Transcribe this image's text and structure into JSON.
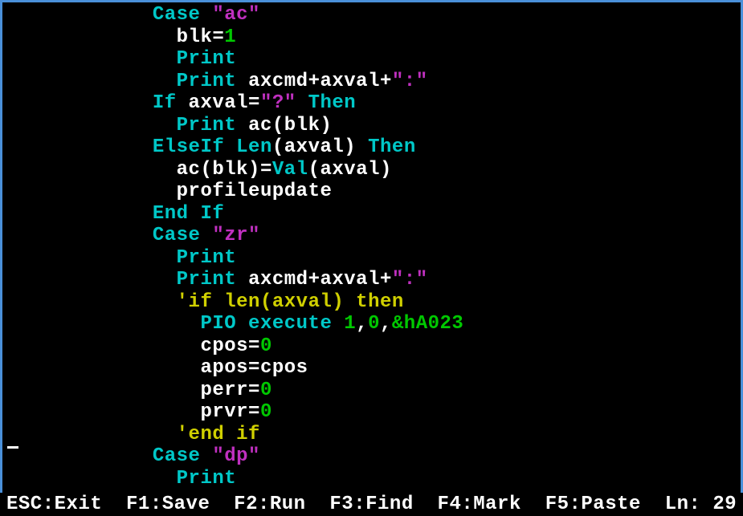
{
  "code": {
    "l1": {
      "indent": "            ",
      "kw": "Case",
      "sp": " ",
      "str": "\"ac\""
    },
    "l2": {
      "indent": "              ",
      "v1": "blk=",
      "num": "1"
    },
    "l3": {
      "indent": "              ",
      "kw": "Print"
    },
    "l4": {
      "indent": "              ",
      "kw": "Print",
      "sp": " ",
      "v1": "axcmd+axval+",
      "str": "\":\""
    },
    "l5": {
      "indent": "            ",
      "kw1": "If",
      "sp1": " ",
      "v1": "axval=",
      "str": "\"?\"",
      "sp2": " ",
      "kw2": "Then"
    },
    "l6": {
      "indent": "              ",
      "kw": "Print",
      "sp": " ",
      "v1": "ac(blk)"
    },
    "l7": {
      "indent": "            ",
      "kw1": "ElseIf",
      "sp1": " ",
      "kw2": "Len",
      "v1": "(axval)",
      "sp2": " ",
      "kw3": "Then"
    },
    "l8": {
      "indent": "              ",
      "v1": "ac(blk)=",
      "kw": "Val",
      "v2": "(axval)"
    },
    "l9": {
      "indent": "              ",
      "v1": "profileupdate"
    },
    "l10": {
      "indent": "            ",
      "kw": "End If"
    },
    "l11": {
      "indent": "            ",
      "kw": "Case",
      "sp": " ",
      "str": "\"zr\""
    },
    "l12": {
      "indent": "              ",
      "kw": "Print"
    },
    "l13": {
      "indent": "              ",
      "kw": "Print",
      "sp": " ",
      "v1": "axcmd+axval+",
      "str": "\":\""
    },
    "l14": {
      "indent": "              ",
      "comment": "'if len(axval) then"
    },
    "l15": {
      "indent": "                ",
      "kw": "PIO execute",
      "sp": " ",
      "n1": "1",
      "c1": ",",
      "n2": "0",
      "c2": ",",
      "n3": "&hA023"
    },
    "l16": {
      "indent": "                ",
      "v1": "cpos=",
      "num": "0"
    },
    "l17": {
      "indent": "                ",
      "v1": "apos=cpos"
    },
    "l18": {
      "indent": "                ",
      "v1": "perr=",
      "num": "0"
    },
    "l19": {
      "indent": "                ",
      "v1": "prvr=",
      "num": "0"
    },
    "l20": {
      "indent": "              ",
      "comment": "'end if"
    },
    "l21": {
      "indent": "            ",
      "kw": "Case",
      "sp": " ",
      "str": "\"dp\""
    },
    "l22": {
      "indent": "              ",
      "kw": "Print"
    }
  },
  "status": {
    "esc": "ESC:Exit",
    "f1": "F1:Save",
    "f2": "F2:Run",
    "f3": "F3:Find",
    "f4": "F4:Mark",
    "f5": "F5:Paste",
    "ln_label": "Ln: ",
    "ln_value": "29"
  }
}
